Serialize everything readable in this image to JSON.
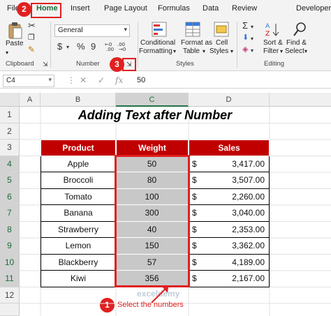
{
  "ribbon": {
    "tabs": [
      {
        "label": "File"
      },
      {
        "label": "Home"
      },
      {
        "label": "Insert"
      },
      {
        "label": "Page Layout"
      },
      {
        "label": "Formulas"
      },
      {
        "label": "Data"
      },
      {
        "label": "Review"
      },
      {
        "label": "Developer"
      }
    ],
    "clipboard": {
      "paste_label": "Paste",
      "group_label": "Clipboard"
    },
    "number": {
      "format_value": "General",
      "symbols": {
        "currency": "$",
        "percent": "%",
        "comma": "9"
      },
      "group_label": "Number"
    },
    "styles": {
      "conditional_formatting": [
        "Conditional",
        "Formatting"
      ],
      "format_as_table": [
        "Format as",
        "Table"
      ],
      "cell_styles": [
        "Cell",
        "Styles"
      ],
      "group_label": "Styles"
    },
    "editing": {
      "sort_filter": [
        "Sort &",
        "Filter"
      ],
      "find_select": [
        "Find &",
        "Select"
      ],
      "group_label": "Editing"
    }
  },
  "steps": {
    "one": "1",
    "two": "2",
    "three": "3"
  },
  "formula_bar": {
    "name_box": "C4",
    "value": "50",
    "fx": "fx"
  },
  "columns": [
    "A",
    "B",
    "C",
    "D"
  ],
  "rows": [
    "1",
    "2",
    "3",
    "4",
    "5",
    "6",
    "7",
    "8",
    "9",
    "10",
    "11",
    "12"
  ],
  "sheet": {
    "title": "Adding Text after Number",
    "headers": {
      "product": "Product",
      "weight": "Weight",
      "sales": "Sales"
    },
    "data": [
      {
        "product": "Apple",
        "weight": "50",
        "currency": "$",
        "sales": "3,417.00"
      },
      {
        "product": "Broccoli",
        "weight": "80",
        "currency": "$",
        "sales": "3,507.00"
      },
      {
        "product": "Tomato",
        "weight": "100",
        "currency": "$",
        "sales": "2,260.00"
      },
      {
        "product": "Banana",
        "weight": "300",
        "currency": "$",
        "sales": "3,040.00"
      },
      {
        "product": "Strawberry",
        "weight": "40",
        "currency": "$",
        "sales": "2,353.00"
      },
      {
        "product": "Lemon",
        "weight": "150",
        "currency": "$",
        "sales": "3,362.00"
      },
      {
        "product": "Blackberry",
        "weight": "57",
        "currency": "$",
        "sales": "4,189.00"
      },
      {
        "product": "Kiwi",
        "weight": "356",
        "currency": "$",
        "sales": "2,167.00"
      }
    ]
  },
  "annotation": {
    "note": "Select the numbers"
  },
  "watermark": "exceldemy",
  "colors": {
    "accent": "#e02020",
    "header_fill": "#c00000",
    "selected_fill": "#c8c8c8",
    "excel_green": "#217346"
  }
}
